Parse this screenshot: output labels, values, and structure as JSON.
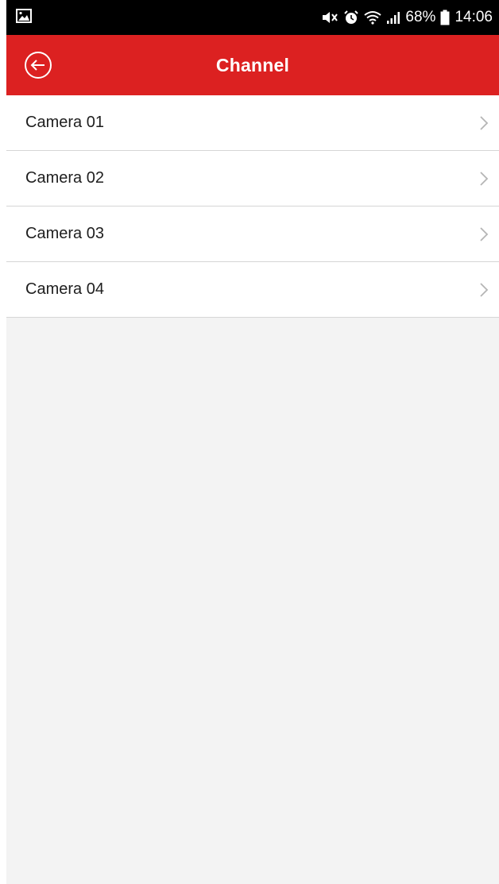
{
  "status_bar": {
    "battery_percent": "68%",
    "time": "14:06",
    "icons": [
      "gallery-notification-icon",
      "mute-icon",
      "alarm-icon",
      "wifi-icon",
      "signal-icon",
      "battery-icon"
    ]
  },
  "app_bar": {
    "title": "Channel",
    "back_icon": "back-arrow-circle-icon",
    "color": "#dc2121"
  },
  "channels": [
    {
      "label": "Camera 01"
    },
    {
      "label": "Camera 02"
    },
    {
      "label": "Camera 03"
    },
    {
      "label": "Camera 04"
    }
  ],
  "colors": {
    "background": "#f3f3f3",
    "divider": "#d6d6d6",
    "chevron": "#b5b5b5"
  }
}
